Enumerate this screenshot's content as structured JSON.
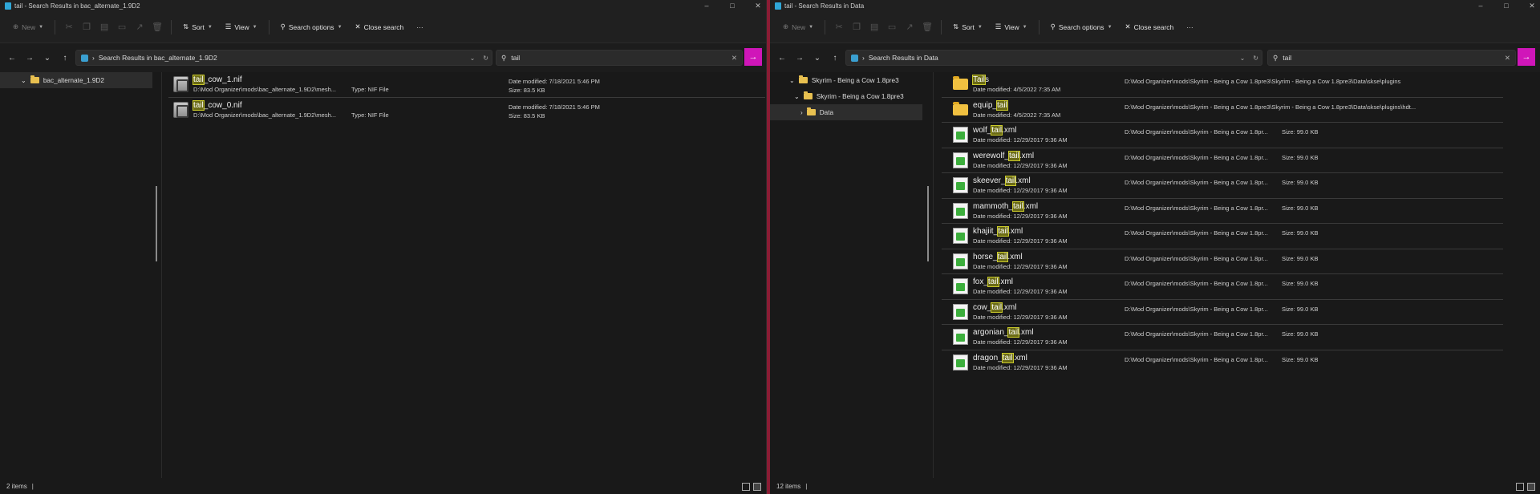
{
  "left": {
    "title": "tail - Search Results in bac_alternate_1.9D2",
    "cmd": {
      "new": "New",
      "sort": "Sort",
      "view": "View",
      "search_options": "Search options",
      "close_search": "Close search",
      "more": "···"
    },
    "address": "Search Results in bac_alternate_1.9D2",
    "search": "tail",
    "tree": [
      {
        "label": "bac_alternate_1.9D2"
      }
    ],
    "items": [
      {
        "pre": "",
        "hl": "tail",
        "post": "_cow_1.nif",
        "path": "D:\\Mod Organizer\\mods\\bac_alternate_1.9D2\\mesh...",
        "type": "Type: NIF File",
        "date": "Date modified: 7/18/2021 5:46 PM",
        "size": "Size: 83.5 KB"
      },
      {
        "pre": "",
        "hl": "tail",
        "post": "_cow_0.nif",
        "path": "D:\\Mod Organizer\\mods\\bac_alternate_1.9D2\\mesh...",
        "type": "Type: NIF File",
        "date": "Date modified: 7/18/2021 5:46 PM",
        "size": "Size: 83.5 KB"
      }
    ],
    "status": "2 items"
  },
  "right": {
    "title": "tail - Search Results in Data",
    "cmd": {
      "new": "New",
      "sort": "Sort",
      "view": "View",
      "search_options": "Search options",
      "close_search": "Close search",
      "more": "···"
    },
    "address": "Search Results in Data",
    "search": "tail",
    "tree": [
      {
        "label": "Skyrim - Being a Cow 1.8pre3"
      },
      {
        "label": "Skyrim - Being a Cow 1.8pre3"
      },
      {
        "label": "Data"
      }
    ],
    "items": [
      {
        "kind": "folder",
        "pre": "",
        "hl": "Tail",
        "post": "s",
        "date": "Date modified: 4/5/2022 7:35 AM",
        "path": "D:\\Mod Organizer\\mods\\Skyrim - Being a Cow 1.8pre3\\Skyrim - Being a Cow 1.8pre3\\Data\\skse\\plugins",
        "size": ""
      },
      {
        "kind": "folder",
        "pre": "equip_",
        "hl": "tail",
        "post": "",
        "date": "Date modified: 4/5/2022 7:35 AM",
        "path": "D:\\Mod Organizer\\mods\\Skyrim - Being a Cow 1.8pre3\\Skyrim - Being a Cow 1.8pre3\\Data\\skse\\plugins\\hdt...",
        "size": ""
      },
      {
        "kind": "xml",
        "pre": "wolf_",
        "hl": "tail",
        "post": ".xml",
        "date": "Date modified: 12/29/2017 9:36 AM",
        "path": "D:\\Mod Organizer\\mods\\Skyrim - Being a Cow 1.8pr...",
        "size": "Size: 99.0 KB"
      },
      {
        "kind": "xml",
        "pre": "werewolf_",
        "hl": "tail",
        "post": ".xml",
        "date": "Date modified: 12/29/2017 9:36 AM",
        "path": "D:\\Mod Organizer\\mods\\Skyrim - Being a Cow 1.8pr...",
        "size": "Size: 99.0 KB"
      },
      {
        "kind": "xml",
        "pre": "skeever_",
        "hl": "tail",
        "post": ".xml",
        "date": "Date modified: 12/29/2017 9:36 AM",
        "path": "D:\\Mod Organizer\\mods\\Skyrim - Being a Cow 1.8pr...",
        "size": "Size: 99.0 KB"
      },
      {
        "kind": "xml",
        "pre": "mammoth_",
        "hl": "tail",
        "post": ".xml",
        "date": "Date modified: 12/29/2017 9:36 AM",
        "path": "D:\\Mod Organizer\\mods\\Skyrim - Being a Cow 1.8pr...",
        "size": "Size: 99.0 KB"
      },
      {
        "kind": "xml",
        "pre": "khajiit_",
        "hl": "tail",
        "post": ".xml",
        "date": "Date modified: 12/29/2017 9:36 AM",
        "path": "D:\\Mod Organizer\\mods\\Skyrim - Being a Cow 1.8pr...",
        "size": "Size: 99.0 KB"
      },
      {
        "kind": "xml",
        "pre": "horse_",
        "hl": "tail",
        "post": ".xml",
        "date": "Date modified: 12/29/2017 9:36 AM",
        "path": "D:\\Mod Organizer\\mods\\Skyrim - Being a Cow 1.8pr...",
        "size": "Size: 99.0 KB"
      },
      {
        "kind": "xml",
        "pre": "fox_",
        "hl": "tail",
        "post": ".xml",
        "date": "Date modified: 12/29/2017 9:36 AM",
        "path": "D:\\Mod Organizer\\mods\\Skyrim - Being a Cow 1.8pr...",
        "size": "Size: 99.0 KB"
      },
      {
        "kind": "xml",
        "pre": "cow_",
        "hl": "tail",
        "post": ".xml",
        "date": "Date modified: 12/29/2017 9:36 AM",
        "path": "D:\\Mod Organizer\\mods\\Skyrim - Being a Cow 1.8pr...",
        "size": "Size: 99.0 KB"
      },
      {
        "kind": "xml",
        "pre": "argonian_",
        "hl": "tail",
        "post": ".xml",
        "date": "Date modified: 12/29/2017 9:36 AM",
        "path": "D:\\Mod Organizer\\mods\\Skyrim - Being a Cow 1.8pr...",
        "size": "Size: 99.0 KB"
      },
      {
        "kind": "xml",
        "pre": "dragon_",
        "hl": "tail",
        "post": ".xml",
        "date": "Date modified: 12/29/2017 9:36 AM",
        "path": "D:\\Mod Organizer\\mods\\Skyrim - Being a Cow 1.8pr...",
        "size": "Size: 99.0 KB"
      }
    ],
    "status": "12 items"
  },
  "colors": {
    "accent": "#d016b9",
    "highlight": "#6b6b16",
    "divider": "#8a1c34"
  }
}
